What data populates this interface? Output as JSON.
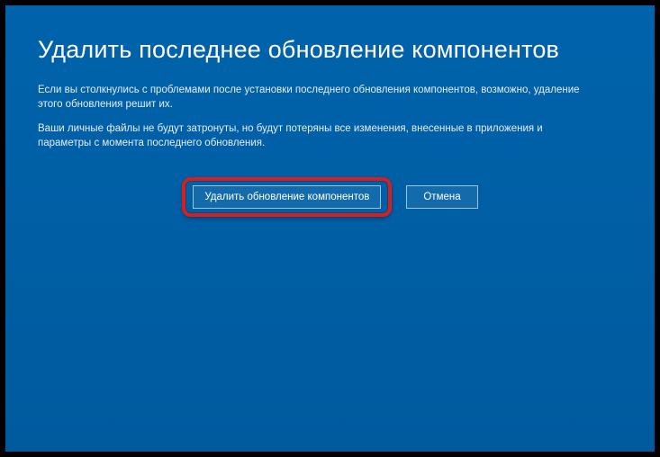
{
  "title": "Удалить последнее обновление компонентов",
  "description1": "Если вы столкнулись с проблемами после установки последнего обновления компонентов, возможно, удаление этого обновления решит их.",
  "description2": "Ваши личные файлы не будут затронуты, но будут потеряны все изменения, внесенные в приложения и параметры с момента последнего обновления.",
  "buttons": {
    "primary": "Удалить обновление компонентов",
    "cancel": "Отмена"
  }
}
